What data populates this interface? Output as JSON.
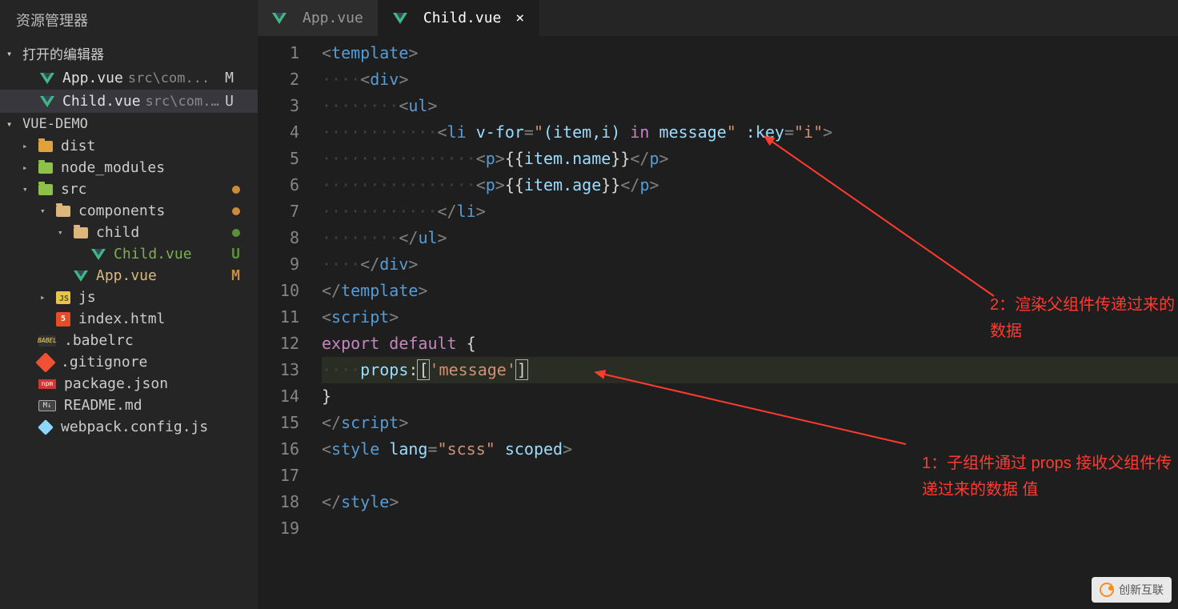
{
  "explorer": {
    "title": "资源管理器",
    "openEditorsHeader": "打开的编辑器",
    "openEditors": [
      {
        "name": "App.vue",
        "path": "src\\com...",
        "badge": "M",
        "active": false
      },
      {
        "name": "Child.vue",
        "path": "src\\com...",
        "badge": "U",
        "active": true
      }
    ],
    "projectName": "VUE-DEMO",
    "tree": [
      {
        "type": "folder",
        "name": "dist",
        "indent": 1,
        "icon": "dist",
        "chev": "▸"
      },
      {
        "type": "folder",
        "name": "node_modules",
        "indent": 1,
        "icon": "nm",
        "chev": "▸"
      },
      {
        "type": "folder",
        "name": "src",
        "indent": 1,
        "icon": "green",
        "chev": "▾",
        "status": "dot-orange"
      },
      {
        "type": "folder",
        "name": "components",
        "indent": 2,
        "icon": "folder",
        "chev": "▾",
        "status": "dot-orange"
      },
      {
        "type": "folder",
        "name": "child",
        "indent": 3,
        "icon": "folder",
        "chev": "▾",
        "status": "dot-green"
      },
      {
        "type": "file",
        "name": "Child.vue",
        "indent": 4,
        "icon": "vue",
        "badge": "U",
        "color": "#7eae4f"
      },
      {
        "type": "file",
        "name": "App.vue",
        "indent": 3,
        "icon": "vue",
        "badge": "M",
        "color": "#d7ba7d"
      },
      {
        "type": "folder",
        "name": "js",
        "indent": 2,
        "icon": "js",
        "chev": "▸"
      },
      {
        "type": "file",
        "name": "index.html",
        "indent": 2,
        "icon": "html"
      },
      {
        "type": "file",
        "name": ".babelrc",
        "indent": 1,
        "icon": "babel"
      },
      {
        "type": "file",
        "name": ".gitignore",
        "indent": 1,
        "icon": "git"
      },
      {
        "type": "file",
        "name": "package.json",
        "indent": 1,
        "icon": "npm"
      },
      {
        "type": "file",
        "name": "README.md",
        "indent": 1,
        "icon": "md"
      },
      {
        "type": "file",
        "name": "webpack.config.js",
        "indent": 1,
        "icon": "wp"
      }
    ]
  },
  "tabs": [
    {
      "label": "App.vue",
      "active": false
    },
    {
      "label": "Child.vue",
      "active": true
    }
  ],
  "code": {
    "lineNumbers": [
      "1",
      "2",
      "3",
      "4",
      "5",
      "6",
      "7",
      "8",
      "9",
      "10",
      "11",
      "12",
      "13",
      "14",
      "15",
      "16",
      "17",
      "18",
      "19"
    ],
    "lines": [
      {
        "tokens": [
          {
            "t": "<",
            "c": "tag-bracket"
          },
          {
            "t": "template",
            "c": "tag-name"
          },
          {
            "t": ">",
            "c": "tag-bracket"
          }
        ]
      },
      {
        "indent": 1,
        "tokens": [
          {
            "t": "<",
            "c": "tag-bracket"
          },
          {
            "t": "div",
            "c": "tag-name"
          },
          {
            "t": ">",
            "c": "tag-bracket"
          }
        ]
      },
      {
        "indent": 2,
        "tokens": [
          {
            "t": "<",
            "c": "tag-bracket"
          },
          {
            "t": "ul",
            "c": "tag-name"
          },
          {
            "t": ">",
            "c": "tag-bracket"
          }
        ]
      },
      {
        "indent": 3,
        "tokens": [
          {
            "t": "<",
            "c": "tag-bracket"
          },
          {
            "t": "li",
            "c": "tag-name"
          },
          {
            "t": " ",
            "c": ""
          },
          {
            "t": "v-for",
            "c": "attr-name"
          },
          {
            "t": "=",
            "c": "tag-bracket"
          },
          {
            "t": "\"",
            "c": "attr-value"
          },
          {
            "t": "(item,i) ",
            "c": "prop"
          },
          {
            "t": "in",
            "c": "kw-in"
          },
          {
            "t": " message",
            "c": "prop"
          },
          {
            "t": "\"",
            "c": "attr-value"
          },
          {
            "t": " ",
            "c": ""
          },
          {
            "t": ":key",
            "c": "attr-name"
          },
          {
            "t": "=",
            "c": "tag-bracket"
          },
          {
            "t": "\"i\"",
            "c": "attr-value"
          },
          {
            "t": ">",
            "c": "tag-bracket"
          }
        ]
      },
      {
        "indent": 4,
        "tokens": [
          {
            "t": "<",
            "c": "tag-bracket"
          },
          {
            "t": "p",
            "c": "tag-name"
          },
          {
            "t": ">",
            "c": "tag-bracket"
          },
          {
            "t": "{{",
            "c": "brace"
          },
          {
            "t": "item.name",
            "c": "prop"
          },
          {
            "t": "}}",
            "c": "brace"
          },
          {
            "t": "</",
            "c": "tag-bracket"
          },
          {
            "t": "p",
            "c": "tag-name"
          },
          {
            "t": ">",
            "c": "tag-bracket"
          }
        ]
      },
      {
        "indent": 4,
        "tokens": [
          {
            "t": "<",
            "c": "tag-bracket"
          },
          {
            "t": "p",
            "c": "tag-name"
          },
          {
            "t": ">",
            "c": "tag-bracket"
          },
          {
            "t": "{{",
            "c": "brace"
          },
          {
            "t": "item.age",
            "c": "prop"
          },
          {
            "t": "}}",
            "c": "brace"
          },
          {
            "t": "</",
            "c": "tag-bracket"
          },
          {
            "t": "p",
            "c": "tag-name"
          },
          {
            "t": ">",
            "c": "tag-bracket"
          }
        ]
      },
      {
        "indent": 3,
        "tokens": [
          {
            "t": "</",
            "c": "tag-bracket"
          },
          {
            "t": "li",
            "c": "tag-name"
          },
          {
            "t": ">",
            "c": "tag-bracket"
          }
        ]
      },
      {
        "indent": 2,
        "tokens": [
          {
            "t": "</",
            "c": "tag-bracket"
          },
          {
            "t": "ul",
            "c": "tag-name"
          },
          {
            "t": ">",
            "c": "tag-bracket"
          }
        ]
      },
      {
        "indent": 1,
        "tokens": [
          {
            "t": "</",
            "c": "tag-bracket"
          },
          {
            "t": "div",
            "c": "tag-name"
          },
          {
            "t": ">",
            "c": "tag-bracket"
          }
        ]
      },
      {
        "tokens": [
          {
            "t": "</",
            "c": "tag-bracket"
          },
          {
            "t": "template",
            "c": "tag-name"
          },
          {
            "t": ">",
            "c": "tag-bracket"
          }
        ]
      },
      {
        "tokens": [
          {
            "t": "<",
            "c": "tag-bracket"
          },
          {
            "t": "script",
            "c": "tag-name"
          },
          {
            "t": ">",
            "c": "tag-bracket"
          }
        ]
      },
      {
        "tokens": [
          {
            "t": "export",
            "c": "kw-export"
          },
          {
            "t": " ",
            "c": ""
          },
          {
            "t": "default",
            "c": "kw-default"
          },
          {
            "t": " {",
            "c": "brace"
          }
        ]
      },
      {
        "indent": 1,
        "highlight": true,
        "tokens": [
          {
            "t": "props",
            "c": "prop"
          },
          {
            "t": ":",
            "c": "text-c"
          },
          {
            "t": "[",
            "c": "cursor-box"
          },
          {
            "t": "'message'",
            "c": "string"
          },
          {
            "t": "]",
            "c": "cursor-box"
          }
        ]
      },
      {
        "tokens": [
          {
            "t": "}",
            "c": "brace"
          }
        ]
      },
      {
        "tokens": [
          {
            "t": "</",
            "c": "tag-bracket"
          },
          {
            "t": "script",
            "c": "tag-name"
          },
          {
            "t": ">",
            "c": "tag-bracket"
          }
        ]
      },
      {
        "tokens": [
          {
            "t": "<",
            "c": "tag-bracket"
          },
          {
            "t": "style",
            "c": "tag-name"
          },
          {
            "t": " ",
            "c": ""
          },
          {
            "t": "lang",
            "c": "attr-name"
          },
          {
            "t": "=",
            "c": "tag-bracket"
          },
          {
            "t": "\"scss\"",
            "c": "attr-value"
          },
          {
            "t": " ",
            "c": ""
          },
          {
            "t": "scoped",
            "c": "attr-name"
          },
          {
            "t": ">",
            "c": "tag-bracket"
          }
        ]
      },
      {
        "tokens": []
      },
      {
        "tokens": [
          {
            "t": "</",
            "c": "tag-bracket"
          },
          {
            "t": "style",
            "c": "tag-name"
          },
          {
            "t": ">",
            "c": "tag-bracket"
          }
        ]
      },
      {
        "tokens": []
      }
    ]
  },
  "annotations": {
    "a1": "2：渲染父组件传递过来的数据",
    "a2": "1：子组件通过 props 接收父组件传递过来的数据 值"
  },
  "watermark": "创新互联"
}
